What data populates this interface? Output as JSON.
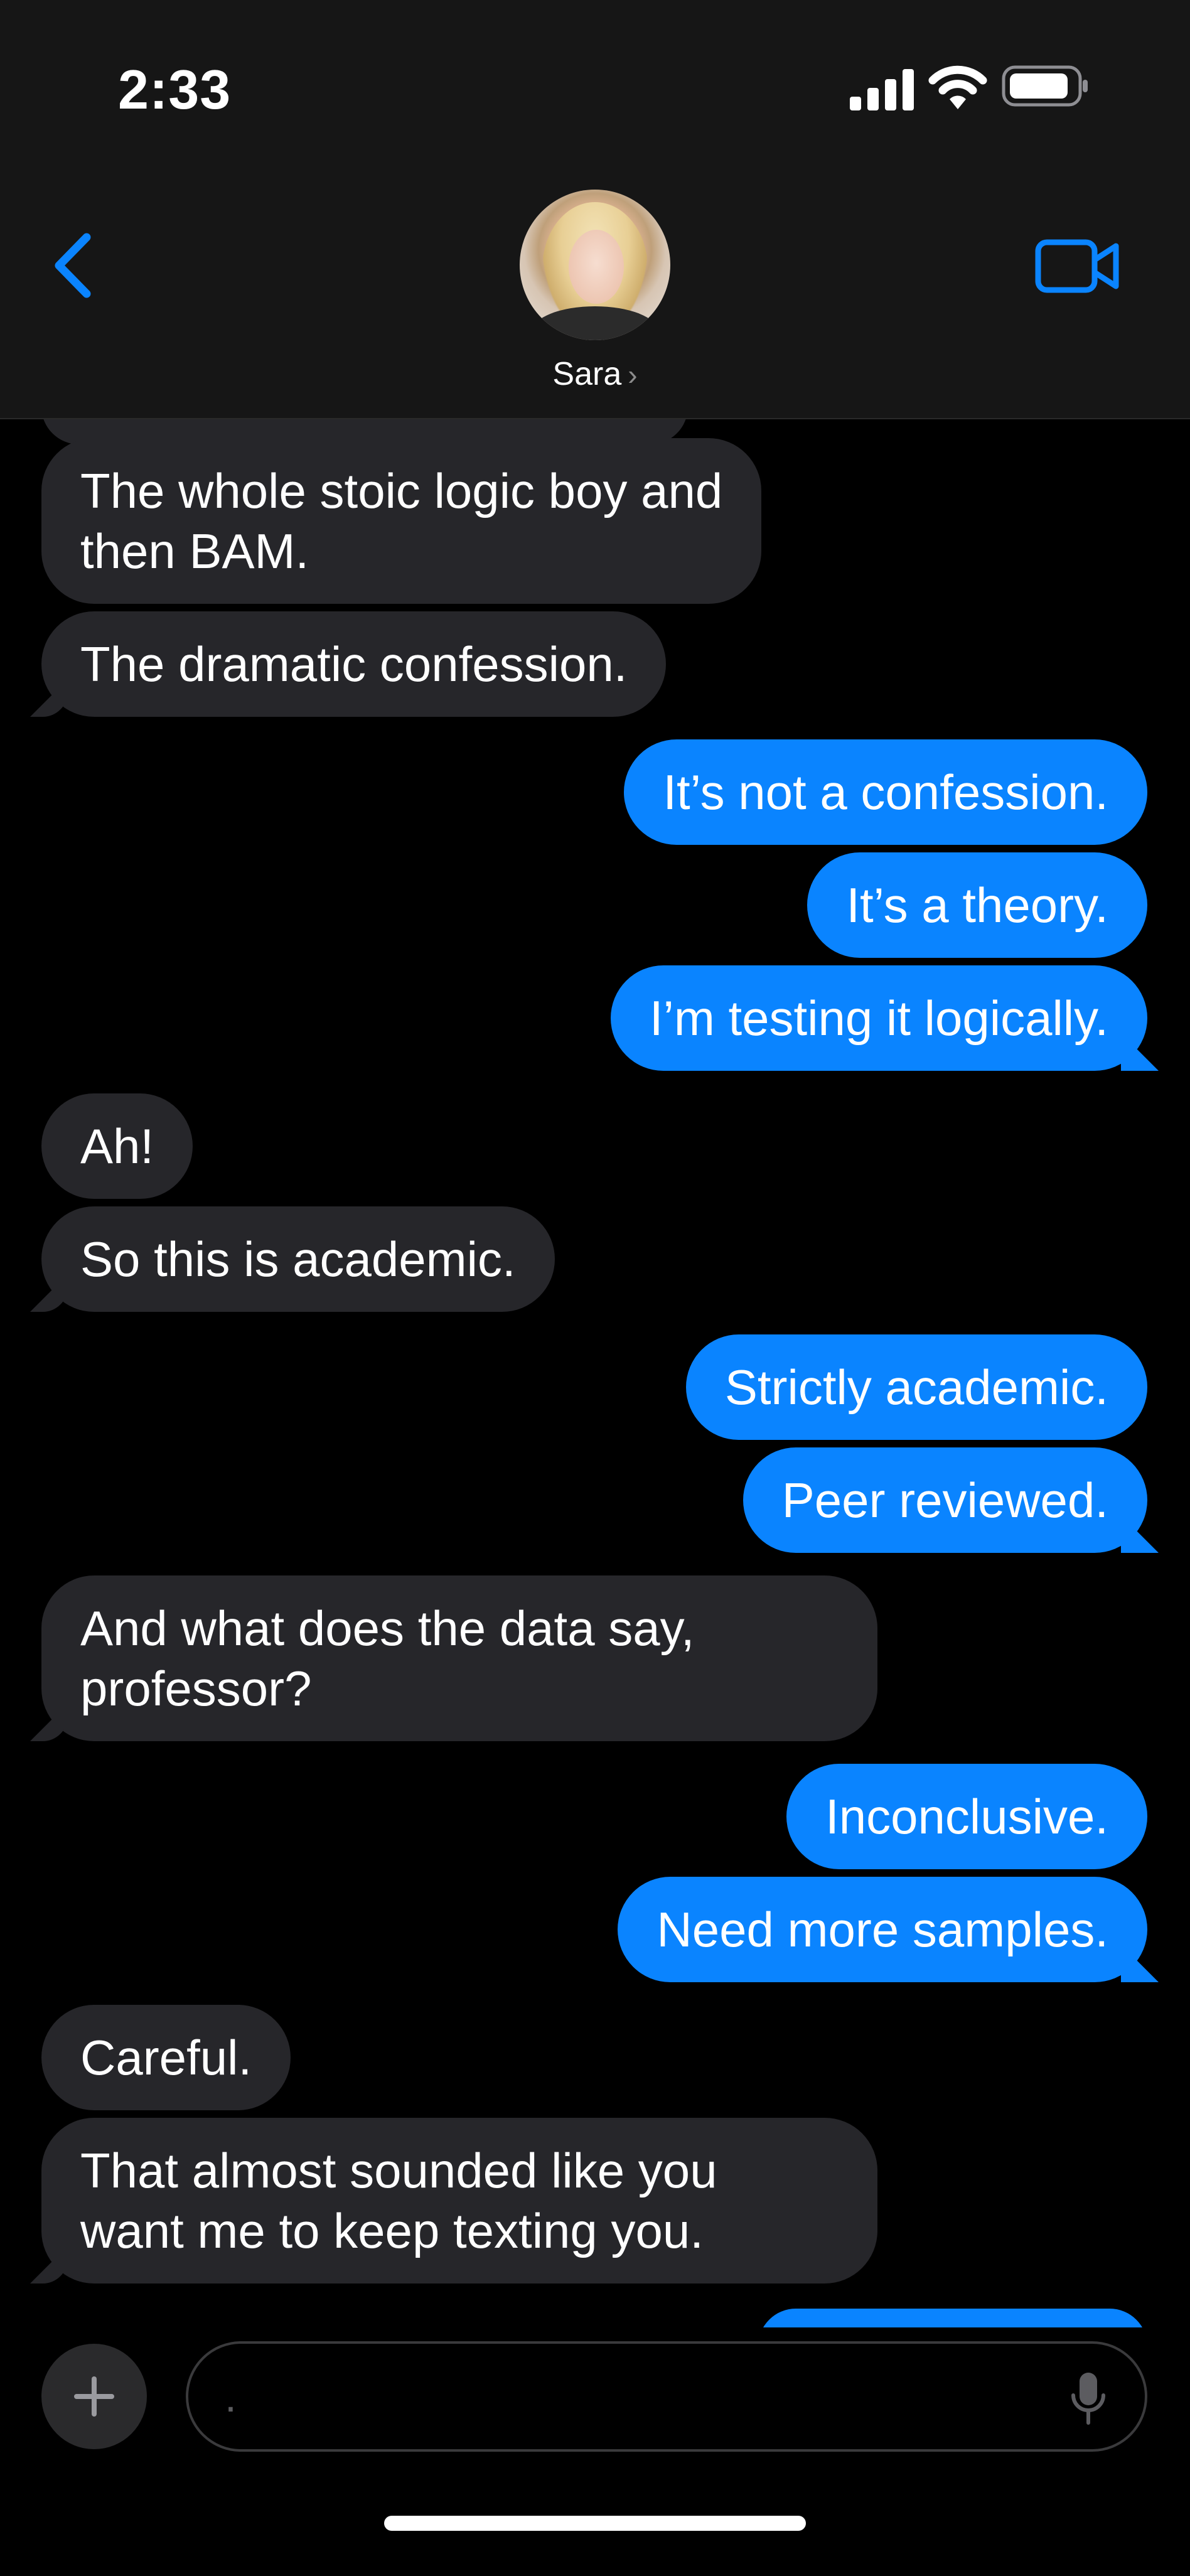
{
  "status_bar": {
    "time": "2:33"
  },
  "header": {
    "contact_name": "Sara",
    "chevron": "›"
  },
  "icons": {
    "back": "chevron-left-icon",
    "video": "video-camera-icon",
    "signal": "cellular-signal-icon",
    "wifi": "wifi-icon",
    "battery": "battery-icon",
    "plus": "plus-icon",
    "mic": "microphone-icon"
  },
  "colors": {
    "accent": "#0a84ff",
    "incoming_bubble": "#26262a",
    "header_bg": "#161616",
    "background": "#000000"
  },
  "messages": [
    {
      "from": "them",
      "text": "The whole stoic logic boy and\nthen BAM."
    },
    {
      "from": "them",
      "text": "The dramatic confession."
    },
    {
      "from": "me",
      "text": "It’s not a confession."
    },
    {
      "from": "me",
      "text": "It’s a theory."
    },
    {
      "from": "me",
      "text": "I’m testing it logically."
    },
    {
      "from": "them",
      "text": "Ah!"
    },
    {
      "from": "them",
      "text": "So this is academic."
    },
    {
      "from": "me",
      "text": "Strictly academic."
    },
    {
      "from": "me",
      "text": "Peer reviewed."
    },
    {
      "from": "them",
      "text": "And what does the data say,\nprofessor?"
    },
    {
      "from": "me",
      "text": "Inconclusive."
    },
    {
      "from": "me",
      "text": "Need more samples."
    },
    {
      "from": "them",
      "text": "Careful."
    },
    {
      "from": "them",
      "text": "That almost sounded like you\nwant me to keep texting you."
    }
  ],
  "composer": {
    "value": "",
    "placeholder": "."
  }
}
